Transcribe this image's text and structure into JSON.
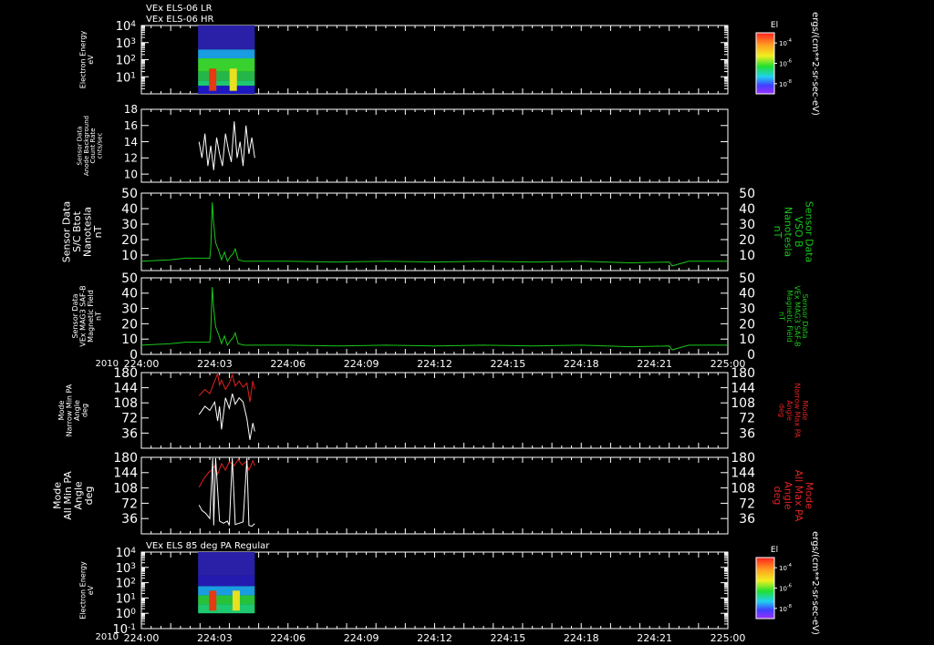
{
  "header": {
    "line1": "VEx ELS-06 LR",
    "line2": "VEx ELS-06 HR"
  },
  "panel7_title": "VEx ELS 85 deg PA Regular",
  "time_axis": {
    "year": "2010",
    "ticks": [
      "224:00",
      "224:03",
      "224:06",
      "224:09",
      "224:12",
      "224:15",
      "224:18",
      "224:21",
      "225:00"
    ],
    "range_minutes": [
      0,
      60
    ]
  },
  "colorbar_top": {
    "title": "El",
    "ticks": [
      "10^-4",
      "10^-6",
      "10^-8"
    ],
    "unit": "ergs/(cm**2-sr-sec-eV)"
  },
  "colorbar_bottom": {
    "title": "El",
    "ticks": [
      "10^-4",
      "10^-6",
      "10^-8"
    ],
    "unit": "ergs/(cm**2-sr-sec-eV)"
  },
  "colors": {
    "white": "#ffffff",
    "green": "#19c819",
    "red": "#e02222",
    "background": "#000000"
  },
  "chart_data": [
    {
      "type": "heatmap",
      "panel": "electron-energy-lr-hr",
      "ylabel": [
        "Electron Energy",
        "eV"
      ],
      "yscale": "log",
      "ylim": [
        1,
        10000
      ],
      "yticks": [
        "10^4",
        "10^3",
        "10^2",
        "10^1"
      ],
      "data_range_minutes": [
        5.8,
        11.6
      ],
      "bands": [
        {
          "from_ev": 1,
          "to_ev": 3,
          "color": "#1d18c0"
        },
        {
          "from_ev": 3,
          "to_ev": 6,
          "color": "#1ec86f"
        },
        {
          "from_ev": 6,
          "to_ev": 20,
          "color": "#25b64a"
        },
        {
          "from_ev": 20,
          "to_ev": 120,
          "color": "#38d12e"
        },
        {
          "from_ev": 120,
          "to_ev": 400,
          "color": "#1a9ce0"
        },
        {
          "from_ev": 400,
          "to_ev": 10000,
          "color": "#2a20a8"
        }
      ],
      "hotspots": [
        {
          "minute": 7.3,
          "color": "#e53a12"
        },
        {
          "minute": 9.4,
          "color": "#e8e020"
        }
      ]
    },
    {
      "type": "line",
      "panel": "anode-background-count-rate",
      "ylabel": [
        "Sensor Data",
        "Anode Background",
        "Count Rate",
        "cnts/sec"
      ],
      "ylim": [
        9,
        18
      ],
      "yticks": [
        18,
        16,
        14,
        12,
        10
      ],
      "series": [
        {
          "color": "#ffffff",
          "x": [
            5.9,
            6.2,
            6.5,
            6.8,
            7.1,
            7.4,
            7.7,
            8.0,
            8.3,
            8.6,
            8.9,
            9.2,
            9.5,
            9.8,
            10.1,
            10.4,
            10.7,
            11.0,
            11.3,
            11.6
          ],
          "y": [
            14,
            12,
            15,
            11,
            13.5,
            10.5,
            14.5,
            12.5,
            11,
            15,
            13,
            11.5,
            16.5,
            12,
            14,
            11,
            16,
            12.5,
            14.5,
            12
          ]
        }
      ]
    },
    {
      "type": "line",
      "panel": "sc-btot",
      "ylabel": [
        "Sensor Data",
        "S/C Btot",
        "Nanotesla",
        "nT"
      ],
      "ylabel_right": [
        "Sensor Data",
        "VSO B",
        "Nanotesla",
        "nT"
      ],
      "ylim": [
        0,
        50
      ],
      "yticks": [
        50,
        40,
        30,
        20,
        10
      ],
      "series": [
        {
          "color": "#19c819",
          "x": [
            0,
            3,
            4.5,
            6,
            7,
            7.1,
            7.25,
            7.4,
            7.6,
            7.9,
            8.2,
            8.5,
            8.8,
            9.1,
            9.4,
            9.6,
            9.9,
            10.5,
            15,
            20,
            25,
            30,
            35,
            40,
            45,
            50,
            54,
            54.3,
            56,
            60
          ],
          "y": [
            6,
            7,
            8,
            8,
            8,
            15,
            44,
            30,
            18,
            13,
            7,
            12,
            6,
            9,
            11,
            14,
            7,
            6,
            6,
            5.5,
            6,
            5.5,
            6,
            5.5,
            6,
            5,
            5.5,
            3,
            6,
            6
          ]
        }
      ]
    },
    {
      "type": "line",
      "panel": "mag-saf-b",
      "ylabel": [
        "Sensor Data",
        "VEx MAG3 SAF-B",
        "Magnetic Field",
        "nT"
      ],
      "ylabel_right": [
        "Sensor Data",
        "VEx MAG3 SAF-B",
        "Magnetic Field",
        "nT"
      ],
      "ylim": [
        0,
        50
      ],
      "yticks": [
        50,
        40,
        30,
        20,
        10,
        0
      ],
      "series": [
        {
          "color": "#19c819",
          "x": [
            0,
            3,
            4.5,
            6,
            7,
            7.1,
            7.25,
            7.4,
            7.6,
            7.9,
            8.2,
            8.5,
            8.8,
            9.1,
            9.4,
            9.6,
            9.9,
            10.5,
            15,
            20,
            25,
            30,
            35,
            40,
            45,
            50,
            54,
            54.3,
            56,
            60
          ],
          "y": [
            6,
            7,
            8,
            8,
            8,
            15,
            44,
            30,
            18,
            13,
            7,
            12,
            6,
            9,
            11,
            14,
            7,
            6,
            6,
            5.5,
            6,
            5.5,
            6,
            5.5,
            6,
            5,
            5.5,
            3,
            6,
            6
          ]
        }
      ]
    },
    {
      "type": "line",
      "panel": "narrow-pa",
      "ylabel": [
        "Mode",
        "Narrow Min PA",
        "Angle",
        "deg"
      ],
      "ylabel_right": [
        "Mode",
        "Narrow Max PA",
        "Angle",
        "deg"
      ],
      "ylim": [
        0,
        180
      ],
      "yticks": [
        180,
        144,
        108,
        72,
        36
      ],
      "series": [
        {
          "color": "#e02222",
          "x": [
            5.9,
            6.5,
            7.0,
            7.5,
            7.8,
            8.0,
            8.2,
            8.6,
            9.0,
            9.3,
            9.6,
            10.0,
            10.4,
            10.8,
            11.1,
            11.4,
            11.6
          ],
          "y": [
            125,
            140,
            130,
            160,
            178,
            150,
            162,
            140,
            155,
            175,
            148,
            160,
            145,
            155,
            110,
            160,
            140
          ]
        },
        {
          "color": "#ffffff",
          "x": [
            5.9,
            6.5,
            7.0,
            7.5,
            7.8,
            8.0,
            8.2,
            8.6,
            9.0,
            9.3,
            9.6,
            10.0,
            10.4,
            10.8,
            11.1,
            11.4,
            11.6
          ],
          "y": [
            80,
            100,
            90,
            110,
            65,
            100,
            45,
            120,
            95,
            130,
            105,
            120,
            110,
            70,
            20,
            60,
            40
          ]
        }
      ]
    },
    {
      "type": "line",
      "panel": "all-pa",
      "ylabel": [
        "Mode",
        "All Min PA",
        "Angle",
        "deg"
      ],
      "ylabel_right": [
        "Mode",
        "All Max PA",
        "Angle",
        "deg"
      ],
      "ylim": [
        0,
        180
      ],
      "yticks": [
        180,
        144,
        108,
        72,
        36
      ],
      "series": [
        {
          "color": "#e02222",
          "x": [
            5.9,
            6.4,
            6.9,
            7.2,
            7.5,
            7.8,
            8.2,
            8.6,
            9.0,
            9.5,
            9.9,
            10.3,
            10.7,
            11.0,
            11.4,
            11.6
          ],
          "y": [
            110,
            130,
            145,
            150,
            160,
            140,
            165,
            150,
            170,
            160,
            175,
            162,
            170,
            150,
            172,
            160
          ]
        },
        {
          "color": "#ffffff",
          "x": [
            5.9,
            6.2,
            6.6,
            7.0,
            7.3,
            7.4,
            7.6,
            8.0,
            8.4,
            8.8,
            9.0,
            9.3,
            9.6,
            10.0,
            10.4,
            10.8,
            11.0,
            11.3,
            11.6
          ],
          "y": [
            68,
            55,
            48,
            36,
            178,
            20,
            178,
            30,
            25,
            30,
            20,
            178,
            22,
            25,
            28,
            178,
            20,
            18,
            24
          ]
        }
      ]
    },
    {
      "type": "heatmap",
      "panel": "electron-energy-85deg-pa",
      "ylabel": [
        "Electron Energy",
        "eV"
      ],
      "yscale": "log",
      "ylim": [
        0.1,
        10000
      ],
      "yticks": [
        "10^4",
        "10^3",
        "10^2",
        "10^1",
        "10^0",
        "10^-1"
      ],
      "data_range_minutes": [
        5.8,
        11.6
      ],
      "bands": [
        {
          "from_ev": 1,
          "to_ev": 4,
          "color": "#1ec86f"
        },
        {
          "from_ev": 4,
          "to_ev": 15,
          "color": "#28c238"
        },
        {
          "from_ev": 15,
          "to_ev": 60,
          "color": "#1a9ce0"
        },
        {
          "from_ev": 60,
          "to_ev": 300,
          "color": "#241ab0"
        },
        {
          "from_ev": 300,
          "to_ev": 10000,
          "color": "#2a20a8"
        }
      ],
      "hotspots": [
        {
          "minute": 7.3,
          "color": "#e53a12"
        },
        {
          "minute": 9.7,
          "color": "#e8e020"
        }
      ]
    }
  ]
}
